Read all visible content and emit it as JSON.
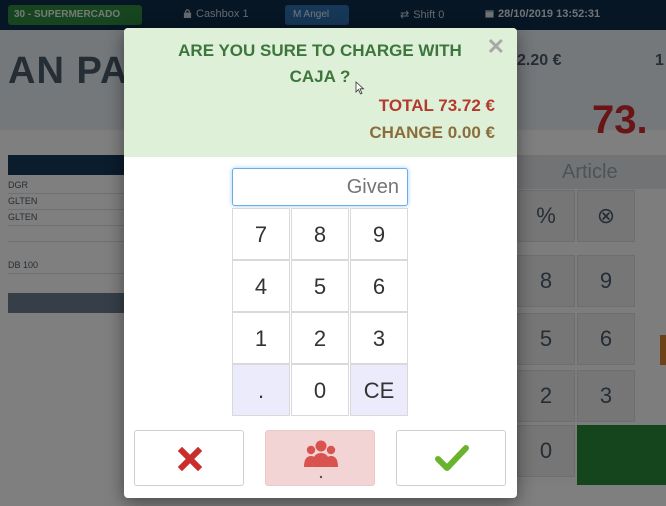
{
  "topbar": {
    "store": "30 - SUPERMERCADO",
    "cashbox": "Cashbox 1",
    "user": "M Angel",
    "shift": "Shift 0",
    "datetime": "28/10/2019 13:52:31"
  },
  "background": {
    "product_title": "AN PAS",
    "unit_price": "2.20 €",
    "qty": "1",
    "total_big": "73.",
    "article_header": "Article",
    "ticket_lines": [
      "DGR",
      "GLTEN",
      "GLTEN",
      "",
      "DB 100"
    ],
    "keypad": [
      "%",
      "⊗",
      "8",
      "9",
      "5",
      "6",
      "2",
      "3",
      "0"
    ]
  },
  "dialog": {
    "question_line1": "ARE YOU SURE TO CHARGE WITH",
    "question_line2": "CAJA ?",
    "total_label": "TOTAL 73.72 €",
    "change_label": "CHANGE 0.00 €",
    "given_placeholder": "Given",
    "keys": {
      "k7": "7",
      "k8": "8",
      "k9": "9",
      "k4": "4",
      "k5": "5",
      "k6": "6",
      "k1": "1",
      "k2": "2",
      "k3": "3",
      "dot": ".",
      "k0": "0",
      "ce": "CE"
    },
    "buttons": {
      "cancel_icon": "x-mark-icon",
      "customer_icon": "users-icon",
      "confirm_icon": "checkmark-icon"
    }
  },
  "colors": {
    "header_bg": "#dff0d8",
    "question": "#3c763d",
    "total": "#b23b2e",
    "change": "#8a6d3b",
    "cancel": "#c9302c",
    "confirm": "#6ab42d",
    "customer": "#d9534f"
  }
}
